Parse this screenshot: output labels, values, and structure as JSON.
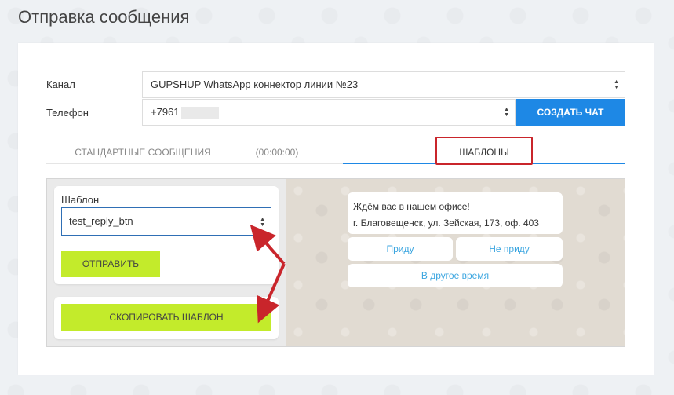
{
  "page": {
    "title": "Отправка сообщения"
  },
  "form": {
    "channel_label": "Канал",
    "channel_value": "GUPSHUP WhatsApp коннектор линии №23",
    "phone_label": "Телефон",
    "phone_value": "+7961",
    "create_chat": "СОЗДАТЬ ЧАТ"
  },
  "tabs": {
    "standard": "СТАНДАРТНЫЕ СООБЩЕНИЯ",
    "timer": "(00:00:00)",
    "templates": "ШАБЛОНЫ"
  },
  "template_panel": {
    "label": "Шаблон",
    "selected": "test_reply_btn",
    "send_button": "ОТПРАВИТЬ",
    "copy_button": "СКОПИРОВАТЬ ШАБЛОН"
  },
  "preview": {
    "line1": "Ждём вас в нашем офисе!",
    "line2": "г. Благовещенск, ул. Зейская, 173, оф. 403",
    "buttons": [
      "Приду",
      "Не приду",
      "В другое время"
    ]
  },
  "colors": {
    "primary": "#1e88e5",
    "accent_green": "#c3eb2b",
    "highlight_red": "#c9252b",
    "link_blue": "#3ca6e0"
  }
}
